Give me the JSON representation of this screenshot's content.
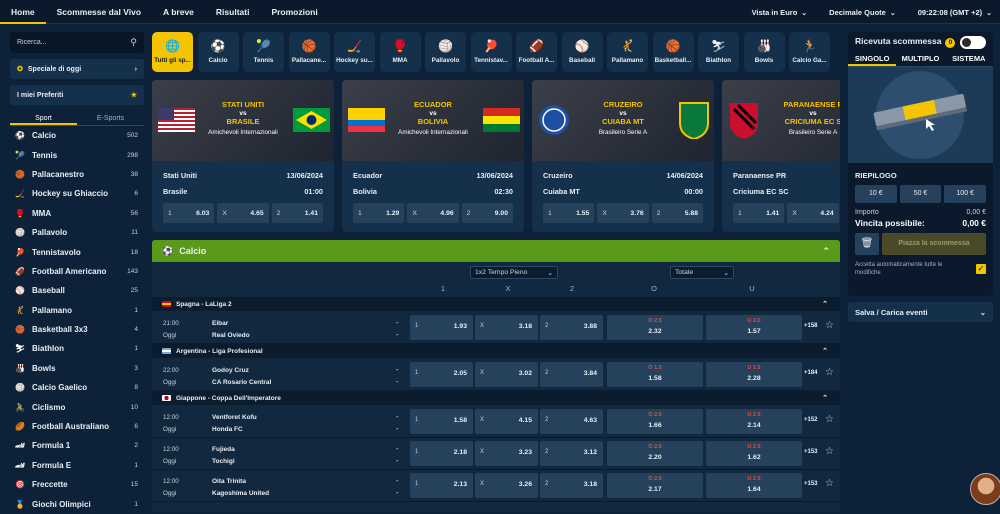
{
  "nav": {
    "items": [
      "Home",
      "Scommesse dal Vivo",
      "A breve",
      "Risultati",
      "Promozioni"
    ],
    "view": "Vista in Euro",
    "odds_format": "Decimale Quote",
    "clock": "09:22:08 (GMT +2)"
  },
  "sidebar": {
    "search_placeholder": "Ricerca...",
    "special": "Speciale di oggi",
    "favorites": "I miei Preferiti",
    "tabs": [
      "Sport",
      "E-Sports"
    ],
    "sports": [
      {
        "name": "Calcio",
        "count": "502",
        "icon": "⚽"
      },
      {
        "name": "Tennis",
        "count": "298",
        "icon": "🎾"
      },
      {
        "name": "Pallacanestro",
        "count": "38",
        "icon": "🏀"
      },
      {
        "name": "Hockey su Ghiaccio",
        "count": "6",
        "icon": "🏒"
      },
      {
        "name": "MMA",
        "count": "56",
        "icon": "🥊"
      },
      {
        "name": "Pallavolo",
        "count": "11",
        "icon": "🏐"
      },
      {
        "name": "Tennistavolo",
        "count": "18",
        "icon": "🏓"
      },
      {
        "name": "Football Americano",
        "count": "143",
        "icon": "🏈"
      },
      {
        "name": "Baseball",
        "count": "25",
        "icon": "⚾"
      },
      {
        "name": "Pallamano",
        "count": "1",
        "icon": "🤾"
      },
      {
        "name": "Basketball 3x3",
        "count": "4",
        "icon": "🏀"
      },
      {
        "name": "Biathlon",
        "count": "1",
        "icon": "⛷"
      },
      {
        "name": "Bowls",
        "count": "3",
        "icon": "🎳"
      },
      {
        "name": "Calcio Gaelico",
        "count": "8",
        "icon": "🏐"
      },
      {
        "name": "Ciclismo",
        "count": "10",
        "icon": "🚴"
      },
      {
        "name": "Football Australiano",
        "count": "6",
        "icon": "🏉"
      },
      {
        "name": "Formula 1",
        "count": "2",
        "icon": "🏎"
      },
      {
        "name": "Formula E",
        "count": "1",
        "icon": "🏎"
      },
      {
        "name": "Freccette",
        "count": "15",
        "icon": "🎯"
      },
      {
        "name": "Giochi Olimpici",
        "count": "1",
        "icon": "🏅"
      }
    ]
  },
  "icon_strip": [
    {
      "label": "Tutti gli sp...",
      "icon": "🌐"
    },
    {
      "label": "Calcio",
      "icon": "⚽"
    },
    {
      "label": "Tennis",
      "icon": "🎾"
    },
    {
      "label": "Pallacane...",
      "icon": "🏀"
    },
    {
      "label": "Hockey su...",
      "icon": "🏒"
    },
    {
      "label": "MMA",
      "icon": "🥊"
    },
    {
      "label": "Pallavolo",
      "icon": "🏐"
    },
    {
      "label": "Tennistav...",
      "icon": "🏓"
    },
    {
      "label": "Football A...",
      "icon": "🏈"
    },
    {
      "label": "Baseball",
      "icon": "⚾"
    },
    {
      "label": "Pallamano",
      "icon": "🤾"
    },
    {
      "label": "Basketball...",
      "icon": "🏀"
    },
    {
      "label": "Biathlon",
      "icon": "⛷"
    },
    {
      "label": "Bowls",
      "icon": "🎳"
    },
    {
      "label": "Calcio Ga...",
      "icon": "🏃"
    }
  ],
  "event_cards": [
    {
      "title1": "STATI UNITI",
      "vs": "vs",
      "title2": "BRASILE",
      "comp": "Amichevoli Internazionali",
      "home": "Stati Uniti",
      "away": "Brasile",
      "date": "13/06/2024",
      "time": "01:00",
      "odds": [
        "6.03",
        "4.65",
        "1.41"
      ]
    },
    {
      "title1": "ECUADOR",
      "vs": "vs",
      "title2": "BOLIVIA",
      "comp": "Amichevoli Internazionali",
      "home": "Ecuador",
      "away": "Bolivia",
      "date": "13/06/2024",
      "time": "02:30",
      "odds": [
        "1.29",
        "4.96",
        "9.00"
      ]
    },
    {
      "title1": "CRUZEIRO",
      "vs": "vs",
      "title2": "CUIABA MT",
      "comp": "Brasileiro Serie A",
      "home": "Cruzeiro",
      "away": "Cuiaba MT",
      "date": "14/06/2024",
      "time": "00:00",
      "odds": [
        "1.55",
        "3.76",
        "5.88"
      ]
    },
    {
      "title1": "PARANAENSE P",
      "vs": "vs",
      "title2": "CRICIUMA EC S",
      "comp": "Brasileiro Serie A",
      "home": "Paranaense PR",
      "away": "Criciuma EC SC",
      "date": "",
      "time": "",
      "odds": [
        "1.41",
        "4.24",
        ""
      ]
    }
  ],
  "odd_keys": [
    "1",
    "X",
    "2"
  ],
  "main": {
    "section": "Calcio",
    "select1": "1x2 Tempo Pieno",
    "select2": "Totale",
    "col_headers": [
      "1",
      "X",
      "2",
      "O",
      "U"
    ],
    "leagues": [
      {
        "name": "Spagna - LaLiga 2",
        "matches": [
          {
            "time": "21:00",
            "day": "Oggi",
            "home": "Eibar",
            "away": "Real Oviedo",
            "o1": "1.93",
            "ox": "3.18",
            "o2": "3.88",
            "line_o": "O 2.5",
            "over": "2.32",
            "line_u": "U 2.5",
            "under": "1.57",
            "more": "+158"
          }
        ]
      },
      {
        "name": "Argentina - Liga Profesional",
        "matches": [
          {
            "time": "22:00",
            "day": "Oggi",
            "home": "Godoy Cruz",
            "away": "CA Rosario Central",
            "o1": "2.05",
            "ox": "3.02",
            "o2": "3.84",
            "line_o": "O 1.5",
            "over": "1.58",
            "line_u": "U 1.5",
            "under": "2.28",
            "more": "+184"
          }
        ]
      },
      {
        "name": "Giappone - Coppa Dell'Imperatore",
        "matches": [
          {
            "time": "12:00",
            "day": "Oggi",
            "home": "Ventforet Kofu",
            "away": "Honda FC",
            "o1": "1.58",
            "ox": "4.15",
            "o2": "4.63",
            "line_o": "O 2.5",
            "over": "1.66",
            "line_u": "U 2.5",
            "under": "2.14",
            "more": "+152"
          },
          {
            "time": "12:00",
            "day": "Oggi",
            "home": "Fujieda",
            "away": "Tochigi",
            "o1": "2.18",
            "ox": "3.23",
            "o2": "3.12",
            "line_o": "O 2.5",
            "over": "2.20",
            "line_u": "U 2.5",
            "under": "1.62",
            "more": "+153"
          },
          {
            "time": "12:00",
            "day": "Oggi",
            "home": "Oita Trinita",
            "away": "Kagoshima United",
            "o1": "2.13",
            "ox": "3.26",
            "o2": "3.18",
            "line_o": "O 2.5",
            "over": "2.17",
            "line_u": "U 2.5",
            "under": "1.64",
            "more": "+153"
          }
        ]
      }
    ]
  },
  "betslip": {
    "title": "Ricevuta scommessa",
    "badge": "0",
    "tabs": [
      "SINGOLO",
      "MULTIPLO",
      "SISTEMA"
    ],
    "summary": "RIEPILOGO",
    "stakes": [
      "10 €",
      "50 €",
      "100 €"
    ],
    "importo_label": "Importo",
    "importo": "0,00 €",
    "vincita_label": "Vincita possibile:",
    "vincita": "0,00 €",
    "place": "Piazza la scommessa",
    "accept": "Accetta automaticamente tutte le modifiche",
    "save": "Salva / Carica eventi"
  },
  "colors": {
    "accent": "#f5c400",
    "section": "#5a9a1a",
    "bg": "#0d2238"
  }
}
